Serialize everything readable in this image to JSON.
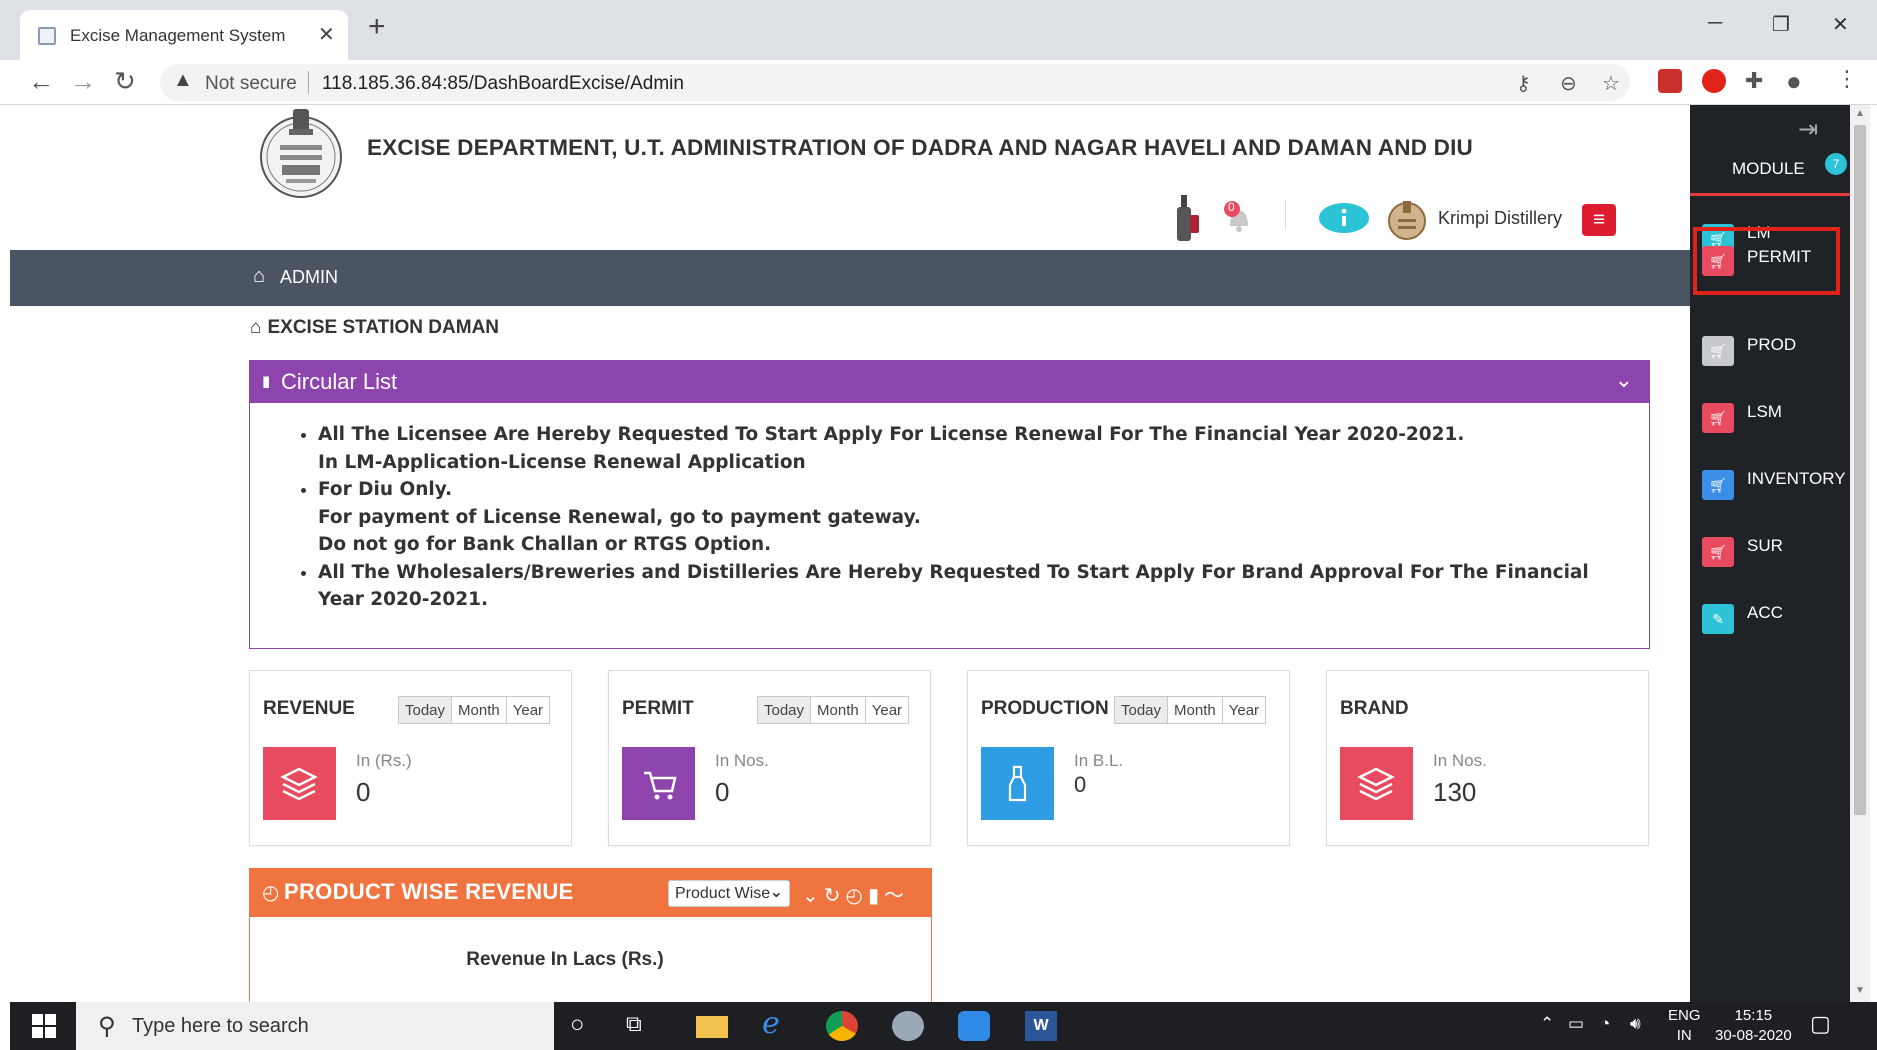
{
  "browser": {
    "tab_title": "Excise Management System",
    "security_label": "Not secure",
    "url": "118.185.36.84:85/DashBoardExcise/Admin"
  },
  "header": {
    "department_title": "EXCISE DEPARTMENT, U.T. ADMINISTRATION OF DADRA AND NAGAR HAVELI AND DAMAN AND DIU",
    "notification_count": "0",
    "user_name": "Krimpi Distillery"
  },
  "nav": {
    "admin_label": "ADMIN"
  },
  "station": {
    "title": "EXCISE STATION DAMAN"
  },
  "circular": {
    "title": "Circular List",
    "items": [
      "All The Licensee Are Hereby Requested To Start Apply For License Renewal For The Financial Year 2020-2021.",
      "In LM-Application-License Renewal Application",
      "For Diu Only.",
      "For payment of License Renewal, go to payment gateway.",
      "Do not go for Bank Challan or RTGS Option.",
      "All The Wholesalers/Breweries and Distilleries Are Hereby Requested To Start Apply For Brand Approval For The Financial Year 2020-2021."
    ]
  },
  "period_buttons": [
    "Today",
    "Month",
    "Year"
  ],
  "stats": [
    {
      "title": "REVENUE",
      "unit": "In (Rs.)",
      "value": "0",
      "color": "#e84a5f",
      "icon": "layers-icon"
    },
    {
      "title": "PERMIT",
      "unit": "In Nos.",
      "value": "0",
      "color": "#8e44ad",
      "icon": "cart-icon"
    },
    {
      "title": "PRODUCTION",
      "unit": "In B.L.",
      "value": "0",
      "color": "#2e9de3",
      "icon": "bottle-icon"
    },
    {
      "title": "BRAND",
      "unit": "In Nos.",
      "value": "130",
      "color": "#e84a5f",
      "icon": "layers-icon"
    }
  ],
  "product_revenue": {
    "title": "PRODUCT WISE REVENUE",
    "select_value": "Product Wise",
    "subtitle": "Revenue In Lacs (Rs.)"
  },
  "module": {
    "title": "MODULE",
    "badge": "7",
    "items": [
      {
        "label": "LM",
        "color": "#2bc3d5",
        "icon": "cart-icon"
      },
      {
        "label": "PERMIT",
        "color": "#e84a5f",
        "icon": "cart-icon"
      },
      {
        "label": "PROD",
        "color": "#c7c9cc",
        "icon": "cart-icon"
      },
      {
        "label": "LSM",
        "color": "#e84a5f",
        "icon": "cart-icon"
      },
      {
        "label": "INVENTORY",
        "color": "#3a8ee6",
        "icon": "cart-icon"
      },
      {
        "label": "SUR",
        "color": "#e84a5f",
        "icon": "cart-icon"
      },
      {
        "label": "ACC",
        "color": "#2bc3d5",
        "icon": "edit-icon"
      }
    ],
    "selected": "PERMIT"
  },
  "taskbar": {
    "search_placeholder": "Type here to search",
    "lang": "ENG",
    "region": "IN",
    "time": "15:15",
    "date": "30-08-2020"
  }
}
